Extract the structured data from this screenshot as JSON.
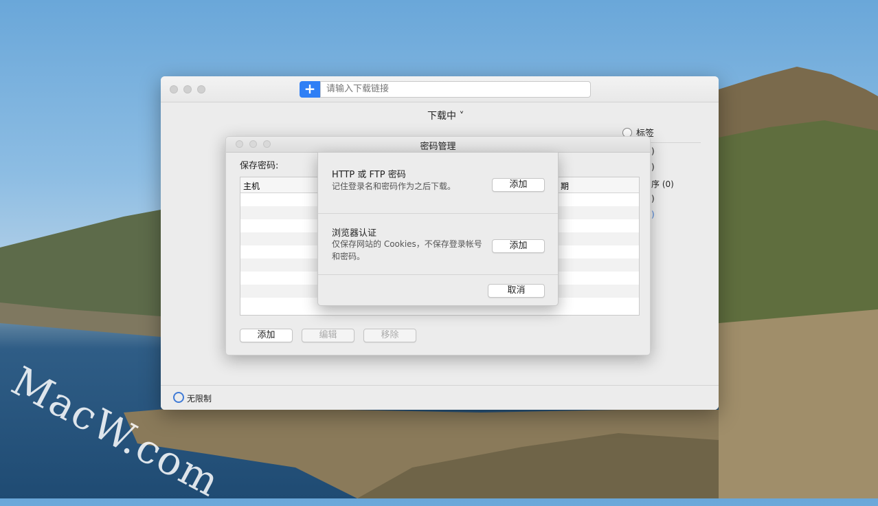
{
  "desktop": {
    "watermark": "MacW.com"
  },
  "main_window": {
    "url_placeholder": "请输入下载链接",
    "add_symbol": "+",
    "status_menu": "下载中 ˅",
    "sidebar": {
      "tags_label": "标签",
      "counts": [
        ")",
        ")",
        "序 (0)",
        ")",
        ")"
      ]
    },
    "speed_limit_label": "无限制"
  },
  "password_manager": {
    "title": "密码管理",
    "saved_label": "保存密码:",
    "columns": {
      "host": "主机",
      "date": "期"
    },
    "buttons": {
      "add": "添加",
      "edit": "编辑",
      "remove": "移除"
    }
  },
  "popover": {
    "http_title": "HTTP 或 FTP 密码",
    "http_desc": "记住登录名和密码作为之后下载。",
    "http_add": "添加",
    "browser_title": "浏览器认证",
    "browser_desc": "仅保存网站的 Cookies，不保存登录帐号和密码。",
    "browser_add": "添加",
    "cancel": "取消"
  }
}
